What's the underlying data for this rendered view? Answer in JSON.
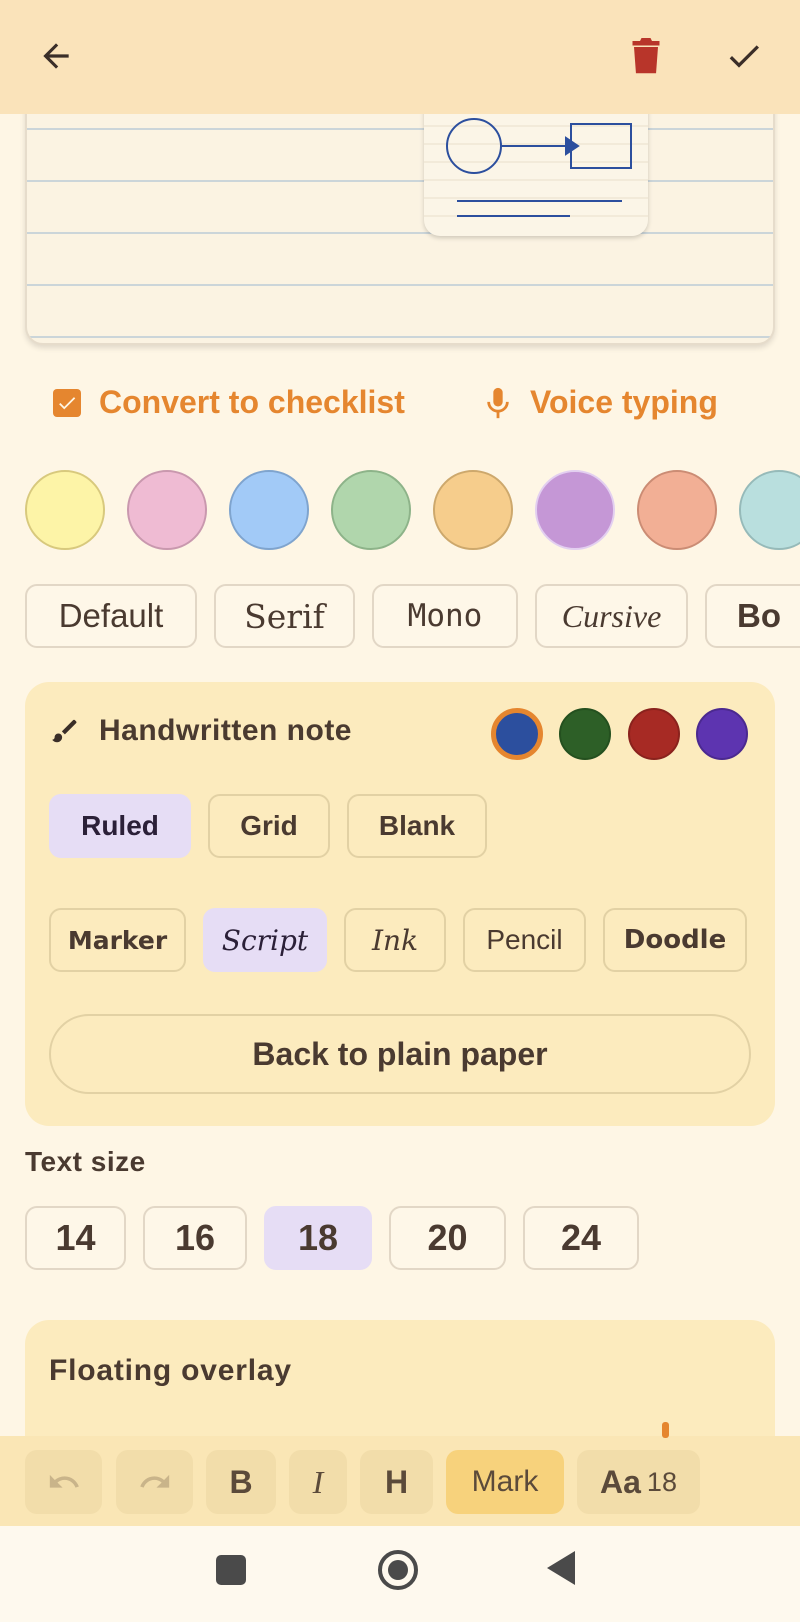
{
  "toolbar_top": {
    "back_icon": "arrow-left-icon",
    "delete_icon": "trash-icon",
    "done_icon": "check-icon",
    "delete_color": "#B8352A"
  },
  "actions": {
    "checklist_label": "Convert to checklist",
    "voice_label": "Voice typing",
    "accent": "#E5862F"
  },
  "note_colors": [
    "#FDF4A7",
    "#EFBBD3",
    "#A2CAF7",
    "#B0D6AC",
    "#F6CD8C",
    "#C597D6",
    "#F2AF95",
    "#B9DFDE"
  ],
  "fonts": [
    "Default",
    "Serif",
    "Mono",
    "Cursive",
    "Bo"
  ],
  "handwritten": {
    "title": "Handwritten note",
    "pen_colors": [
      "#2C4F9E",
      "#2D5F27",
      "#A72A24",
      "#5D34B0"
    ],
    "selected_pen": 0,
    "paper_styles": [
      "Ruled",
      "Grid",
      "Blank"
    ],
    "selected_paper": "Ruled",
    "hand_styles": [
      "Marker",
      "Script",
      "Ink",
      "Pencil",
      "Doodle"
    ],
    "selected_hand": "Script",
    "plain_button": "Back to plain paper"
  },
  "text_size": {
    "label": "Text size",
    "options": [
      "14",
      "16",
      "18",
      "20",
      "24"
    ],
    "selected": "18"
  },
  "overlay": {
    "title": "Floating overlay"
  },
  "format_bar": {
    "bold": "B",
    "italic": "I",
    "heading": "H",
    "mark": "Mark",
    "size_prefix": "Aa",
    "size_value": "18"
  }
}
